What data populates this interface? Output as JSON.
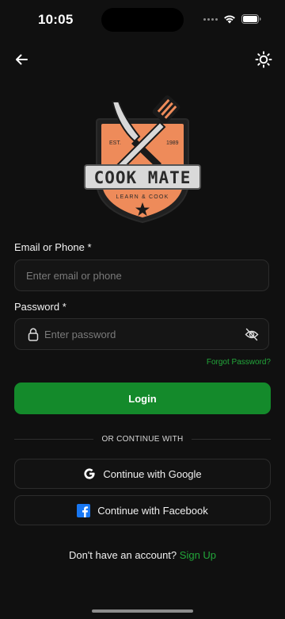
{
  "status_bar": {
    "time": "10:05"
  },
  "header": {
    "back_icon": "arrow-left-icon",
    "theme_icon": "sun-icon"
  },
  "logo": {
    "title": "COOK MATE",
    "tagline": "LEARN & COOK",
    "est_label": "EST.",
    "year": "1989",
    "badge_color": "#ee8b5a"
  },
  "form": {
    "email_label": "Email or Phone *",
    "email_placeholder": "Enter email or phone",
    "email_value": "",
    "password_label": "Password *",
    "password_placeholder": "Enter password",
    "password_value": "",
    "forgot_password": "Forgot Password?",
    "login_button": "Login"
  },
  "divider_text": "OR CONTINUE WITH",
  "social": {
    "google_label": "Continue with Google",
    "facebook_label": "Continue with Facebook"
  },
  "footer": {
    "prompt": "Don't have an account?",
    "signup": "Sign Up"
  },
  "colors": {
    "background": "#101010",
    "accent": "#148a2b",
    "link": "#22a63a",
    "facebook": "#1877f2"
  }
}
